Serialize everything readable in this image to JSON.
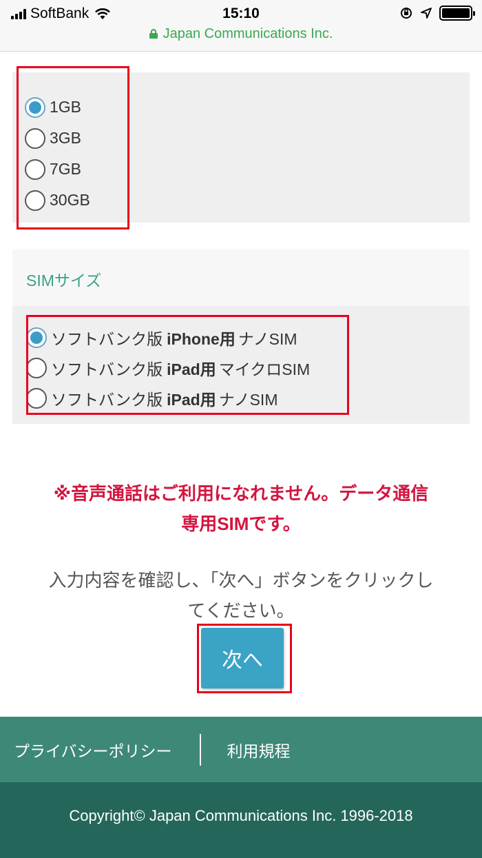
{
  "status_bar": {
    "carrier": "SoftBank",
    "time": "15:10",
    "url": "Japan Communications Inc."
  },
  "plan": {
    "options": [
      {
        "label": "1GB",
        "selected": true
      },
      {
        "label": "3GB",
        "selected": false
      },
      {
        "label": "7GB",
        "selected": false
      },
      {
        "label": "30GB",
        "selected": false
      }
    ]
  },
  "sim": {
    "title": "SIMサイズ",
    "options": [
      {
        "prefix": "ソフトバンク版",
        "device": "iPhone用",
        "size": "ナノSIM",
        "selected": true
      },
      {
        "prefix": "ソフトバンク版",
        "device": "iPad用",
        "size": "マイクロSIM",
        "selected": false
      },
      {
        "prefix": "ソフトバンク版",
        "device": "iPad用",
        "size": "ナノSIM",
        "selected": false
      }
    ]
  },
  "warning": {
    "line1": "※音声通話はご利用になれません。データ通信",
    "line2": "専用SIMです。"
  },
  "instruction": {
    "line1": "入力内容を確認し、「次へ」ボタンをクリックし",
    "line2": "てください。"
  },
  "next_button_label": "次へ",
  "footer": {
    "privacy_label": "プライバシーポリシー",
    "terms_label": "利用規程",
    "copyright": "Copyright© Japan Communications Inc. 1996-2018"
  },
  "colors": {
    "accent": "#3ba3c6",
    "section_title": "#3aa08a",
    "warning": "#d2153f",
    "highlight": "#e8001a",
    "footer_top": "#3e8878",
    "footer_bottom": "#24665a"
  }
}
